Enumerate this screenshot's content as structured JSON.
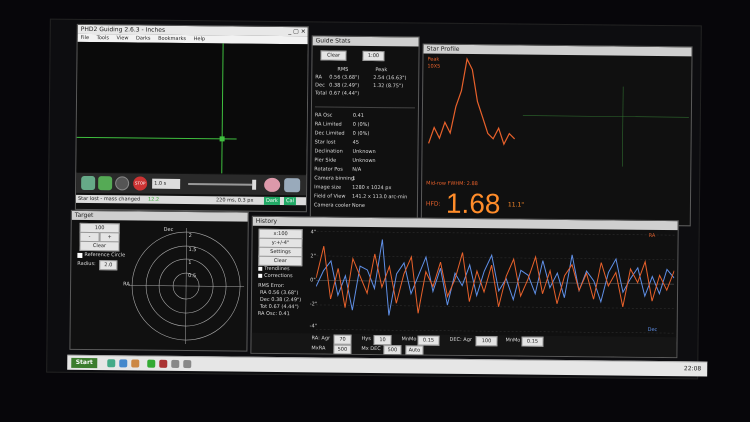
{
  "main_window": {
    "title": "PHD2 Guiding 2.6.3 - Inches",
    "menu": [
      "File",
      "Tools",
      "View",
      "Darks",
      "Bookmarks",
      "Help"
    ],
    "status_text": "Star lost - mass changed",
    "status_value": "12.2",
    "exposure": "1.0 s",
    "status_right": "220 ms, 0.3 px",
    "dark_label": "Dark",
    "cal_label": "Cal"
  },
  "guide_stats": {
    "title": "Guide Stats",
    "clear_label": "Clear",
    "dropdown": "1:00",
    "header_rms": "RMS",
    "header_peak": "Peak",
    "rows": [
      {
        "label": "RA",
        "rms": "0.56 (3.68\")",
        "peak": "2.54 (16.63\")"
      },
      {
        "label": "Dec",
        "rms": "0.38 (2.49\")",
        "peak": "1.32 (8.75\")"
      },
      {
        "label": "Total",
        "rms": "0.67 (4.44\")",
        "peak": ""
      }
    ],
    "info": [
      {
        "k": "RA Osc",
        "v": "0.41"
      },
      {
        "k": "RA Limited",
        "v": "0 (0%)"
      },
      {
        "k": "Dec Limited",
        "v": "0 (0%)"
      },
      {
        "k": "Star lost",
        "v": "45"
      },
      {
        "k": "Declination",
        "v": "Unknown"
      },
      {
        "k": "Pier Side",
        "v": "Unknown"
      },
      {
        "k": "Rotator Pos",
        "v": "N/A"
      },
      {
        "k": "Camera binning",
        "v": "1"
      },
      {
        "k": "Image size",
        "v": "1280 x 1024 px"
      },
      {
        "k": "Field of View",
        "v": "141.2 x 113.0 arc-min"
      },
      {
        "k": "Camera cooler",
        "v": "None"
      }
    ]
  },
  "star_profile": {
    "title": "Star Profile",
    "legend1": "Peak",
    "legend2": "10X5",
    "mid_label": "Mid-row FWHM: 2.88",
    "hfd_label": "HFD:",
    "hfd_value": "1.68",
    "hfd_arcsec": "11.1\"",
    "profile": [
      20,
      35,
      25,
      40,
      30,
      55,
      70,
      100,
      90,
      60,
      45,
      30,
      25,
      35,
      20,
      30,
      25
    ]
  },
  "target": {
    "title": "Target",
    "scale_select": "100",
    "clear_label": "Clear",
    "ref_circle_label": "Reference Circle",
    "radius_label": "Radius:",
    "radius_value": "2.0",
    "dec_label": "Dec",
    "ra_label": "RA",
    "ring_labels": [
      "2",
      "1.5",
      "1",
      "0.5"
    ]
  },
  "history": {
    "title": "History",
    "select1": "x:100",
    "select2": "y:+/-4\"",
    "settings_label": "Settings",
    "clear_label": "Clear",
    "trendlines_label": "Trendlines",
    "corrections_label": "Corrections",
    "rms_title": "RMS Error:",
    "rms_ra": "RA 0.56 (3.68\")",
    "rms_dec": "Dec 0.38 (2.49\")",
    "rms_tot": "Tot 0.67 (4.44\")",
    "ra_osc": "RA Osc: 0.41",
    "y_labels": [
      "4\"",
      "2\"",
      "0\"",
      "-2\"",
      "-4\""
    ],
    "legend_ra": "RA",
    "legend_dec": "Dec",
    "ra_series": [
      0.2,
      2.8,
      -1.5,
      1.0,
      -2.2,
      1.8,
      0.4,
      -1.0,
      2.2,
      -0.5,
      1.2,
      -1.8,
      0.6,
      2.0,
      -2.6,
      0.8,
      -0.4,
      1.6,
      -1.2,
      0.2,
      2.4,
      -1.6,
      0.9,
      -0.8,
      1.4,
      -2.0,
      0.5,
      1.9,
      -1.1,
      0.3,
      2.1,
      -0.9,
      1.0,
      -1.7,
      0.6,
      1.5,
      -0.6,
      0.8,
      -1.3,
      1.7,
      -0.2,
      0.9,
      -1.9,
      1.2,
      0.1,
      1.8,
      -1.4,
      0.7,
      -0.5,
      1.1
    ],
    "dec_series": [
      -0.5,
      0.8,
      1.6,
      -1.2,
      0.4,
      -2.4,
      1.2,
      0.9,
      -0.6,
      3.4,
      -2.8,
      0.6,
      1.5,
      -1.0,
      0.5,
      2.0,
      -0.8,
      1.1,
      -1.9,
      0.7,
      -0.3,
      1.4,
      -1.1,
      0.9,
      2.2,
      -0.7,
      0.3,
      -1.4,
      1.0,
      0.6,
      -0.9,
      1.8,
      -0.4,
      0.8,
      -1.2,
      2.3,
      -0.6,
      1.0,
      0.2,
      -1.5,
      0.9,
      2.0,
      -0.7,
      0.4,
      1.3,
      -1.0,
      0.6,
      -0.8,
      1.2,
      0.5
    ],
    "ra_agr_label": "RA: Agr",
    "ra_agr_value": "70",
    "hyst_label": "Hys",
    "hyst_value": "10",
    "mnmo_label": "MnMo",
    "mnmo_value": "0.15",
    "dec_agr_label": "DEC: Agr",
    "dec_agr_value": "100",
    "dec_mnmo_value": "0.15",
    "mxra_label": "MxRA",
    "mxra_value": "500",
    "mxdec_label": "Mx DEC",
    "mxdec_value": "500",
    "auto_value": "Auto"
  },
  "taskbar": {
    "start_label": "Start",
    "clock": "22:08"
  },
  "colors": {
    "ra": "#5f8fe6",
    "dec": "#e8612b",
    "profile": "#e8612b",
    "hfd": "#ff8c2a",
    "green": "#3fbf3f"
  }
}
